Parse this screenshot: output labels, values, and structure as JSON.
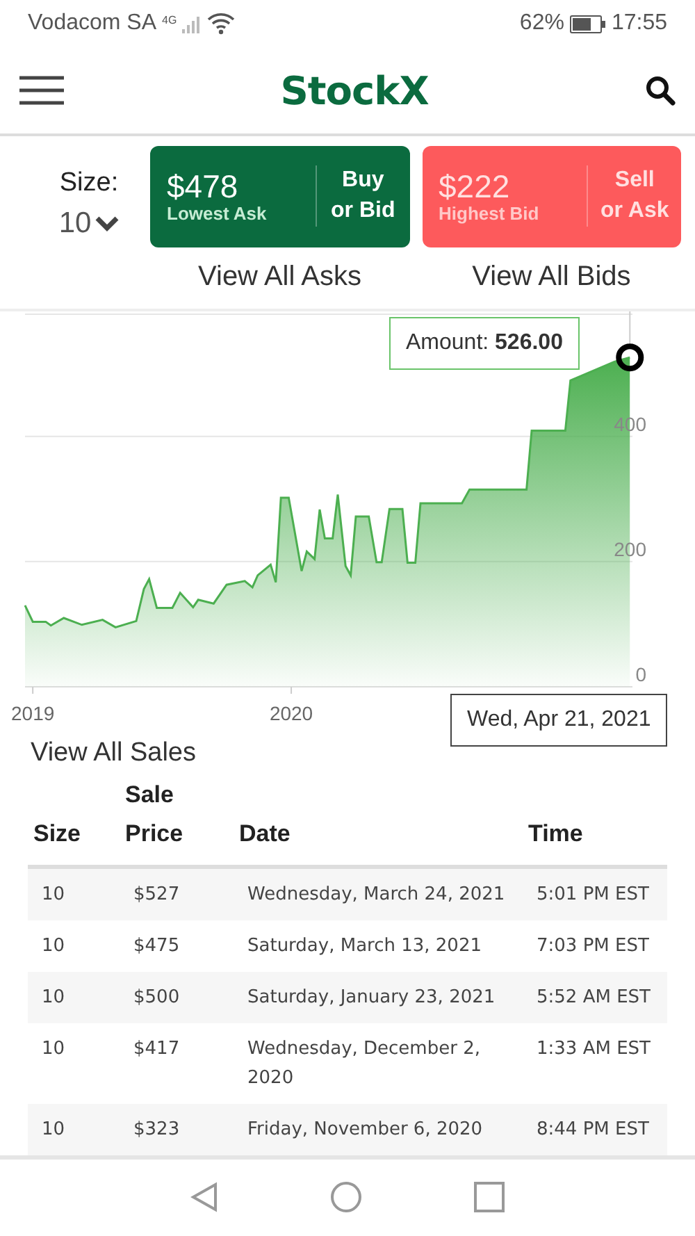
{
  "status_bar": {
    "carrier": "Vodacom SA",
    "network": "4G",
    "battery": "62%",
    "time": "17:55"
  },
  "header": {
    "logo": "StockX"
  },
  "size": {
    "label": "Size:",
    "value": "10"
  },
  "actions": [
    {
      "kind": "buy",
      "price": "$478",
      "caption": "Lowest Ask",
      "action_top": "Buy",
      "action_bottom": "or Bid",
      "link": "View All Asks"
    },
    {
      "kind": "sell",
      "price": "$222",
      "caption": "Highest Bid",
      "action_top": "Sell",
      "action_bottom": "or Ask",
      "link": "View All Bids"
    }
  ],
  "chart": {
    "tooltip": "Amount: **526.00**",
    "date_tooltip": "Wed, Apr 21, 2021",
    "chart_data": {
      "type": "area",
      "xlim": [
        2018.97,
        2021.32
      ],
      "ylim": [
        0,
        595
      ],
      "xticks": [
        {
          "value": 2019,
          "label": "2019"
        },
        {
          "value": 2020,
          "label": "2020"
        }
      ],
      "yticks": [
        0,
        200,
        400
      ],
      "x": [
        2018.97,
        2019.0,
        2019.05,
        2019.07,
        2019.12,
        2019.19,
        2019.27,
        2019.32,
        2019.4,
        2019.43,
        2019.45,
        2019.48,
        2019.54,
        2019.57,
        2019.62,
        2019.64,
        2019.7,
        2019.75,
        2019.82,
        2019.85,
        2019.87,
        2019.92,
        2019.94,
        2019.96,
        2019.99,
        2020.04,
        2020.06,
        2020.09,
        2020.11,
        2020.13,
        2020.16,
        2020.18,
        2020.21,
        2020.23,
        2020.25,
        2020.3,
        2020.33,
        2020.35,
        2020.38,
        2020.43,
        2020.45,
        2020.48,
        2020.5,
        2020.66,
        2020.69,
        2020.91,
        2020.93,
        2021.06,
        2021.08,
        2021.25,
        2021.31
      ],
      "series": [
        {
          "color": "#4caf50",
          "values": [
            130,
            104,
            104,
            98,
            110,
            99,
            107,
            95,
            105,
            156,
            172,
            126,
            126,
            150,
            127,
            139,
            133,
            163,
            169,
            159,
            178,
            195,
            167,
            302,
            302,
            185,
            216,
            204,
            283,
            237,
            237,
            307,
            193,
            178,
            272,
            272,
            199,
            199,
            284,
            284,
            198,
            198,
            293,
            293,
            315,
            315,
            409,
            409,
            489,
            519,
            526
          ]
        }
      ]
    }
  },
  "sales": {
    "title": "View All Sales",
    "columns": [
      "Size",
      "Sale Price",
      "Date",
      "Time"
    ],
    "rows": [
      [
        "10",
        "$527",
        "Wednesday, March 24, 2021",
        "5:01 PM EST"
      ],
      [
        "10",
        "$475",
        "Saturday, March 13, 2021",
        "7:03 PM EST"
      ],
      [
        "10",
        "$500",
        "Saturday, January 23, 2021",
        "5:52 AM EST"
      ],
      [
        "10",
        "$417",
        "Wednesday, December 2, 2020",
        "1:33 AM EST"
      ],
      [
        "10",
        "$323",
        "Friday, November 6, 2020",
        "8:44 PM EST"
      ]
    ]
  }
}
